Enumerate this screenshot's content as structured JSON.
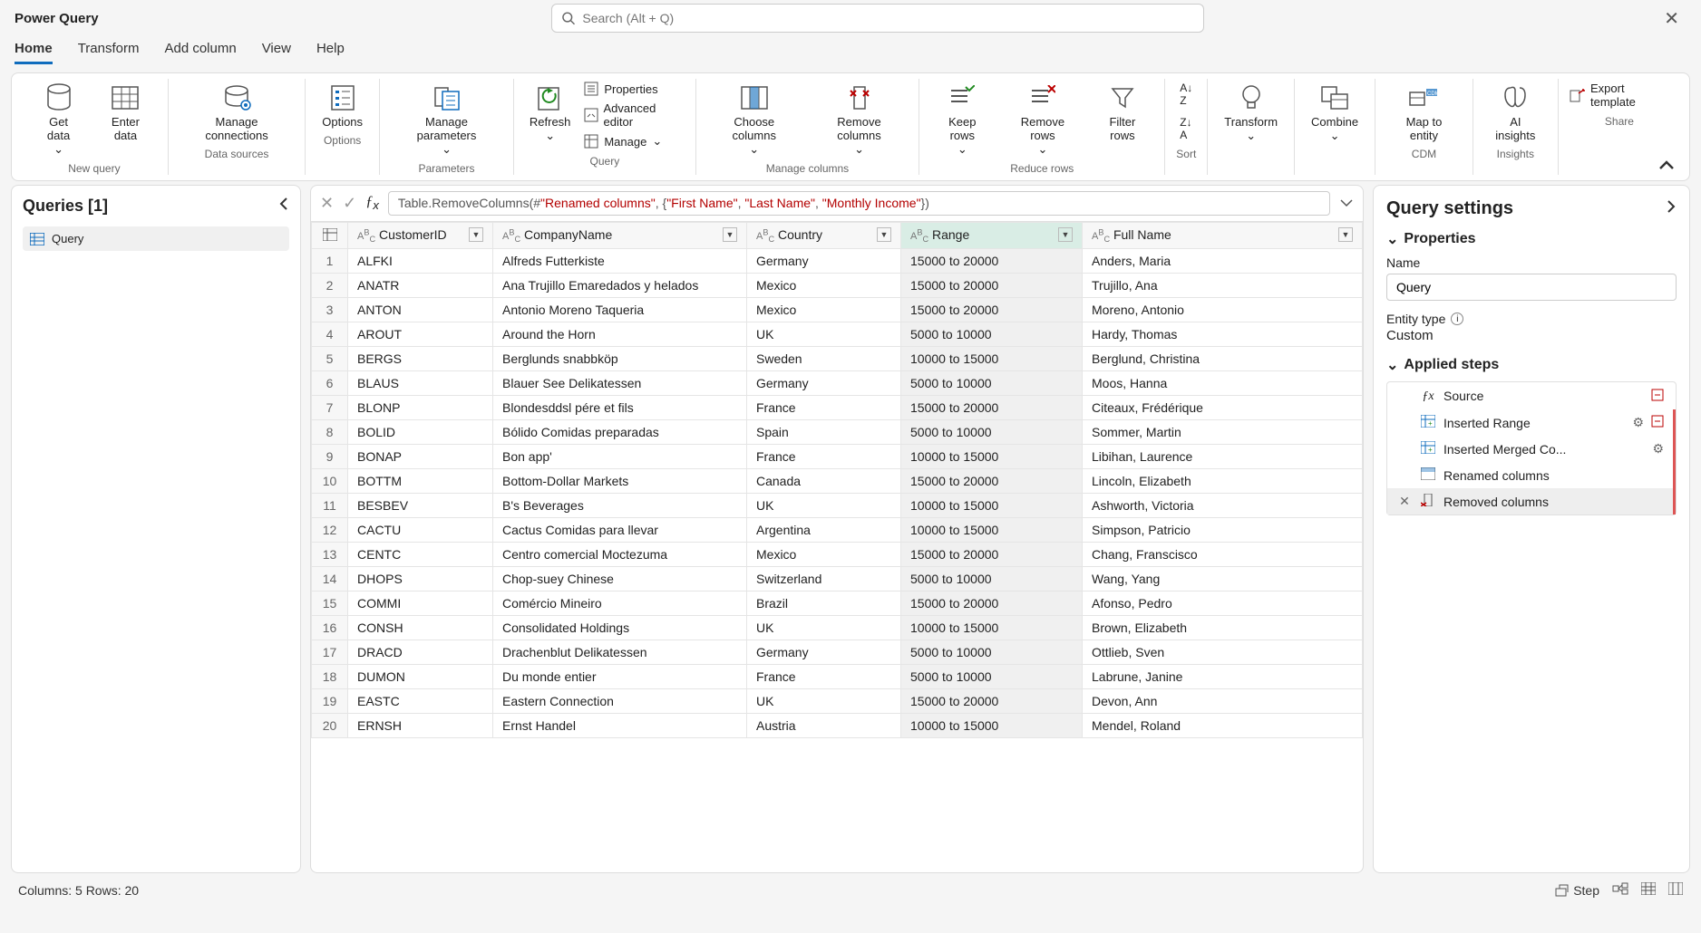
{
  "title": "Power Query",
  "search": {
    "placeholder": "Search (Alt + Q)"
  },
  "tabs": [
    "Home",
    "Transform",
    "Add column",
    "View",
    "Help"
  ],
  "ribbon": {
    "groups": [
      {
        "label": "New query",
        "items": [
          "Get data",
          "Enter data"
        ]
      },
      {
        "label": "Data sources",
        "items": [
          "Manage connections"
        ]
      },
      {
        "label": "Options",
        "items": [
          "Options"
        ]
      },
      {
        "label": "Parameters",
        "items": [
          "Manage parameters"
        ]
      },
      {
        "label": "Query",
        "items": [
          "Refresh"
        ],
        "small": [
          "Properties",
          "Advanced editor",
          "Manage"
        ]
      },
      {
        "label": "Manage columns",
        "items": [
          "Choose columns",
          "Remove columns"
        ]
      },
      {
        "label": "Reduce rows",
        "items": [
          "Keep rows",
          "Remove rows",
          "Filter rows"
        ]
      },
      {
        "label": "Sort",
        "items": [
          ""
        ]
      },
      {
        "label": "",
        "items": [
          "Transform"
        ]
      },
      {
        "label": "",
        "items": [
          "Combine"
        ]
      },
      {
        "label": "CDM",
        "items": [
          "Map to entity"
        ]
      },
      {
        "label": "Insights",
        "items": [
          "AI insights"
        ]
      },
      {
        "label": "Share",
        "small": [
          "Export template"
        ]
      }
    ]
  },
  "queries": {
    "title": "Queries [1]",
    "items": [
      "Query"
    ]
  },
  "formula": {
    "prefix": "Table.RemoveColumns(#",
    "renamed": "\"Renamed columns\"",
    "mid": ", {",
    "s1": "\"First Name\"",
    "s2": "\"Last Name\"",
    "s3": "\"Monthly Income\"",
    "suffix": "})"
  },
  "columns": [
    "CustomerID",
    "CompanyName",
    "Country",
    "Range",
    "Full Name"
  ],
  "rows": [
    [
      "ALFKI",
      "Alfreds Futterkiste",
      "Germany",
      "15000 to 20000",
      "Anders, Maria"
    ],
    [
      "ANATR",
      "Ana Trujillo Emaredados y helados",
      "Mexico",
      "15000 to 20000",
      "Trujillo, Ana"
    ],
    [
      "ANTON",
      "Antonio Moreno Taqueria",
      "Mexico",
      "15000 to 20000",
      "Moreno, Antonio"
    ],
    [
      "AROUT",
      "Around the Horn",
      "UK",
      "5000 to 10000",
      "Hardy, Thomas"
    ],
    [
      "BERGS",
      "Berglunds snabbköp",
      "Sweden",
      "10000 to 15000",
      "Berglund, Christina"
    ],
    [
      "BLAUS",
      "Blauer See Delikatessen",
      "Germany",
      "5000 to 10000",
      "Moos, Hanna"
    ],
    [
      "BLONP",
      "Blondesddsl pére et fils",
      "France",
      "15000 to 20000",
      "Citeaux, Frédérique"
    ],
    [
      "BOLID",
      "Bólido Comidas preparadas",
      "Spain",
      "5000 to 10000",
      "Sommer, Martin"
    ],
    [
      "BONAP",
      "Bon app'",
      "France",
      "10000 to 15000",
      "Libihan, Laurence"
    ],
    [
      "BOTTM",
      "Bottom-Dollar Markets",
      "Canada",
      "15000 to 20000",
      "Lincoln, Elizabeth"
    ],
    [
      "BESBEV",
      "B's Beverages",
      "UK",
      "10000 to 15000",
      "Ashworth, Victoria"
    ],
    [
      "CACTU",
      "Cactus Comidas para llevar",
      "Argentina",
      "10000 to 15000",
      "Simpson, Patricio"
    ],
    [
      "CENTC",
      "Centro comercial Moctezuma",
      "Mexico",
      "15000 to 20000",
      "Chang, Franscisco"
    ],
    [
      "DHOPS",
      "Chop-suey Chinese",
      "Switzerland",
      "5000 to 10000",
      "Wang, Yang"
    ],
    [
      "COMMI",
      "Comércio Mineiro",
      "Brazil",
      "15000 to 20000",
      "Afonso, Pedro"
    ],
    [
      "CONSH",
      "Consolidated Holdings",
      "UK",
      "10000 to 15000",
      "Brown, Elizabeth"
    ],
    [
      "DRACD",
      "Drachenblut Delikatessen",
      "Germany",
      "5000 to 10000",
      "Ottlieb, Sven"
    ],
    [
      "DUMON",
      "Du monde entier",
      "France",
      "5000 to 10000",
      "Labrune, Janine"
    ],
    [
      "EASTC",
      "Eastern Connection",
      "UK",
      "15000 to 20000",
      "Devon, Ann"
    ],
    [
      "ERNSH",
      "Ernst Handel",
      "Austria",
      "10000 to 15000",
      "Mendel, Roland"
    ]
  ],
  "settings": {
    "title": "Query settings",
    "properties": "Properties",
    "name_label": "Name",
    "name_value": "Query",
    "entity_label": "Entity type",
    "entity_value": "Custom",
    "steps_title": "Applied steps",
    "steps": [
      {
        "label": "Source",
        "gear": false,
        "x": false,
        "first": true,
        "dash": true
      },
      {
        "label": "Inserted Range",
        "gear": true,
        "x": false,
        "dash": true
      },
      {
        "label": "Inserted Merged Co...",
        "gear": true,
        "x": false
      },
      {
        "label": "Renamed columns",
        "gear": false,
        "x": false
      },
      {
        "label": "Removed columns",
        "gear": false,
        "x": true,
        "selected": true
      }
    ]
  },
  "status": {
    "left": "Columns: 5   Rows: 20",
    "step": "Step"
  }
}
